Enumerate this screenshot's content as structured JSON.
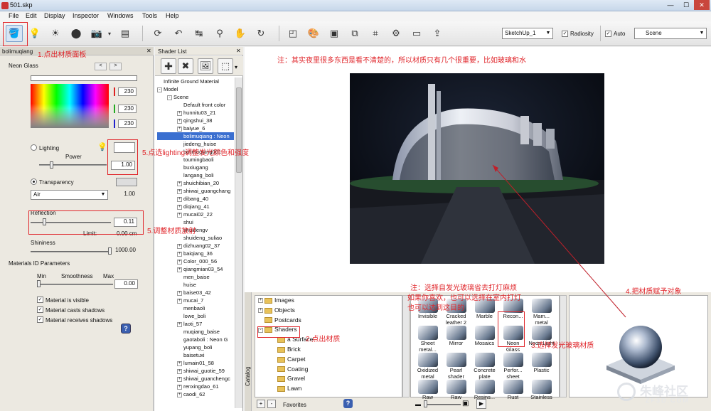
{
  "window": {
    "title": "501.skp"
  },
  "menu": [
    "File",
    "Edit",
    "Display",
    "Inspector",
    "Windows",
    "Tools",
    "Help"
  ],
  "toolbar": {
    "renderer_select": "SketchUp_1",
    "radiosity_label": "Radiosity",
    "radiosity_checked": true,
    "auto_label": "Auto",
    "auto_checked": true,
    "scene_select": "Scene"
  },
  "material_panel": {
    "material_name": "bolimuqiang",
    "material_type": "Neon Glass",
    "rgb": [
      "230",
      "230",
      "230"
    ],
    "lighting_label": "Lighting",
    "power_label": "Power",
    "power_value": "1.00",
    "transparency_label": "Transparency",
    "transparency_medium": "Air",
    "transparency_value": "1.00",
    "reflection_label": "Reflection",
    "reflection_value": "0.11",
    "limit_label": "Limit:",
    "limit_value": "0.00 cm",
    "shininess_label": "Shininess",
    "shininess_value": "1000.00",
    "id_params_title": "Materials ID Parameters",
    "min_label": "Min",
    "smoothness_label": "Smoothness",
    "max_label": "Max",
    "smoothness_value": "0.00",
    "checks": [
      {
        "label": "Material is visible",
        "checked": true
      },
      {
        "label": "Material casts shadows",
        "checked": true
      },
      {
        "label": "Material receives shadows",
        "checked": true
      }
    ],
    "help_icon": "?"
  },
  "shader_list": {
    "title": "Shader List",
    "items": [
      {
        "label": "Infinite Ground Material",
        "level": 0,
        "expander": ""
      },
      {
        "label": "Model",
        "level": 0,
        "expander": "-"
      },
      {
        "label": "Scene",
        "level": 1,
        "expander": "-"
      },
      {
        "label": "Default front color",
        "level": 2,
        "expander": ""
      },
      {
        "label": "hunnitu03_21",
        "level": 2,
        "expander": "+"
      },
      {
        "label": "qingshui_38",
        "level": 2,
        "expander": "+"
      },
      {
        "label": "baiyue_6",
        "level": 2,
        "expander": "+"
      },
      {
        "label": "bolimuqiang : Neon",
        "level": 2,
        "expander": "",
        "selected": true
      },
      {
        "label": "jiedeng_huise",
        "level": 2,
        "expander": ""
      },
      {
        "label": "bolimuqiang001",
        "level": 2,
        "expander": ""
      },
      {
        "label": "toumingbaoli",
        "level": 2,
        "expander": ""
      },
      {
        "label": "buxiugang",
        "level": 2,
        "expander": ""
      },
      {
        "label": "langang_boli",
        "level": 2,
        "expander": ""
      },
      {
        "label": "shuichibian_20",
        "level": 2,
        "expander": "+"
      },
      {
        "label": "shiwai_guangchang",
        "level": 2,
        "expander": "+"
      },
      {
        "label": "dibang_40",
        "level": 2,
        "expander": "+"
      },
      {
        "label": "diqiang_41",
        "level": 2,
        "expander": "+"
      },
      {
        "label": "mucai02_22",
        "level": 2,
        "expander": "+"
      },
      {
        "label": "shui",
        "level": 2,
        "expander": ""
      },
      {
        "label": "shuidengv",
        "level": 2,
        "expander": ""
      },
      {
        "label": "shuideng_suliao",
        "level": 2,
        "expander": ""
      },
      {
        "label": "dizhuang02_37",
        "level": 2,
        "expander": "+"
      },
      {
        "label": "baiqiang_36",
        "level": 2,
        "expander": "+"
      },
      {
        "label": "Color_000_56",
        "level": 2,
        "expander": "+"
      },
      {
        "label": "qiangmian03_54",
        "level": 2,
        "expander": "+"
      },
      {
        "label": "men_baise",
        "level": 2,
        "expander": ""
      },
      {
        "label": "huise",
        "level": 2,
        "expander": ""
      },
      {
        "label": "baise03_42",
        "level": 2,
        "expander": "+"
      },
      {
        "label": "mucai_7",
        "level": 2,
        "expander": "+"
      },
      {
        "label": "menbaoli",
        "level": 2,
        "expander": ""
      },
      {
        "label": "lowe_boli",
        "level": 2,
        "expander": ""
      },
      {
        "label": "laoti_57",
        "level": 2,
        "expander": "+"
      },
      {
        "label": "muqiang_baise",
        "level": 2,
        "expander": ""
      },
      {
        "label": "gaotaboli : Neon G",
        "level": 2,
        "expander": ""
      },
      {
        "label": "yupang_boli",
        "level": 2,
        "expander": ""
      },
      {
        "label": "baisetuxi",
        "level": 2,
        "expander": ""
      },
      {
        "label": "lumain01_58",
        "level": 2,
        "expander": "+"
      },
      {
        "label": "shiwai_guotie_59",
        "level": 2,
        "expander": "+"
      },
      {
        "label": "shiwai_guanchengc",
        "level": 2,
        "expander": "+"
      },
      {
        "label": "renxingdao_61",
        "level": 2,
        "expander": "+"
      },
      {
        "label": "caodi_62",
        "level": 2,
        "expander": "+"
      }
    ]
  },
  "catalog": {
    "side_label": "Catalog",
    "favorites_label": "Favorites",
    "tree": [
      {
        "label": "Images",
        "expander": "+",
        "level": 0
      },
      {
        "label": "Objects",
        "expander": "+",
        "level": 0
      },
      {
        "label": "Postcards",
        "expander": "",
        "level": 0
      },
      {
        "label": "Shaders",
        "expander": "-",
        "level": 0
      },
      {
        "label": "a Surface",
        "expander": "",
        "level": 1
      },
      {
        "label": "Brick",
        "expander": "",
        "level": 1
      },
      {
        "label": "Carpet",
        "expander": "",
        "level": 1
      },
      {
        "label": "Coating",
        "expander": "",
        "level": 1
      },
      {
        "label": "Gravel",
        "expander": "",
        "level": 1
      },
      {
        "label": "Lawn",
        "expander": "",
        "level": 1
      }
    ],
    "grid": [
      [
        "Invisible",
        "Cracked leather 2",
        "Marble",
        "Recon...",
        "Mam... metal"
      ],
      [
        "Sheet metal...",
        "Mirror",
        "Mosaics",
        "Neon Glass",
        "Neon Light"
      ],
      [
        "Oxidized metal",
        "Pearl shader",
        "Concrete plate",
        "Perfor... sheet",
        "Plastic"
      ],
      [
        "Raw",
        "Raw",
        "Resins...",
        "Rust",
        "Stainless"
      ]
    ]
  },
  "annotations": {
    "a1": "1.点出材质面板",
    "a2": "2.点出材质",
    "a3": "3.选择发光玻璃材质",
    "a4": "4.把材质赋予对象",
    "a5": "5.点选lighting调整发光颜色和强度",
    "a6": "5.调整材质放射",
    "note_top": "注：其实夜里很多东西是看不清楚的，所以材质只有几个很重要，比如玻璃和水",
    "note_catalog_1": "注：选择自发光玻璃省去打灯麻烦",
    "note_catalog_2": "如果你喜欢，也可以选择在室内打灯",
    "note_catalog_3": "也可以达到这目的"
  },
  "watermark": {
    "brand": "朱峰社区",
    "url": "ZF3D.COM"
  }
}
